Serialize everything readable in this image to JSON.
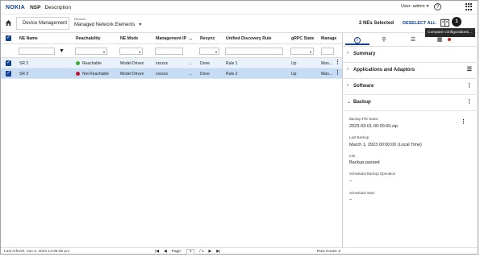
{
  "header": {
    "logo": "NOKIA",
    "app_name": "NSP",
    "description": "Description",
    "user": "User: admin",
    "help": "?"
  },
  "toolbar": {
    "crumb": "Device Management",
    "devices_label": "Devices",
    "devices_value": "Managed Network Elements",
    "selected": "2 NEs Selected",
    "deselect_all": "DESELECT ALL",
    "callout_number": "1",
    "tooltip": "Compare configurations..."
  },
  "table": {
    "columns": [
      "NE Name",
      "Reachability",
      "NE Mode",
      "Management IP",
      "...",
      "Resync",
      "Unified Discovery Rule",
      "gRPC State",
      "Manage"
    ],
    "rows": [
      {
        "name": "SR 2",
        "reach": "Reachable",
        "reach_color": "#3aa935",
        "mode": "Model Driven",
        "ip": "xxxxxx",
        "dots": "...",
        "resync": "Done",
        "rule": "Rule 1",
        "grpc": "Up",
        "manage": "Man..."
      },
      {
        "name": "SR 3",
        "reach": "Not Reachable",
        "reach_color": "#c8102e",
        "mode": "Model Driven",
        "ip": "xxxxxx",
        "dots": "...",
        "resync": "Done",
        "rule": "Rule 2",
        "grpc": "Up",
        "manage": "Man..."
      }
    ]
  },
  "footer": {
    "last_refresh": "Last refresh: Jan 3, 2023 12:05:08 pm",
    "page_label": "Page:",
    "page_value": "1",
    "page_total": "/ 1",
    "row_count": "Row Count: 2"
  },
  "panel": {
    "sections": {
      "summary": "Summary",
      "apps": "Applications and Adaptors",
      "software": "Software",
      "backup": "Backup"
    },
    "backup": {
      "file_label": "Backup File Name",
      "file_value": "2023-03-01-00:00:00.zip",
      "last_label": "Last Backup",
      "last_value": "March 1, 2023 00:00:00 (Local Time)",
      "info_label": "Info",
      "info_value": "Backup passed",
      "sched_op_label": "Scheduled Backup Operation",
      "sched_op_value": "–",
      "sched_start_label": "Scheduled Start",
      "sched_start_value": "–"
    }
  },
  "colors": {
    "brand": "#124191",
    "reachable": "#3aa935",
    "not_reachable": "#c8102e",
    "selected_row": "#c6dcf5"
  }
}
